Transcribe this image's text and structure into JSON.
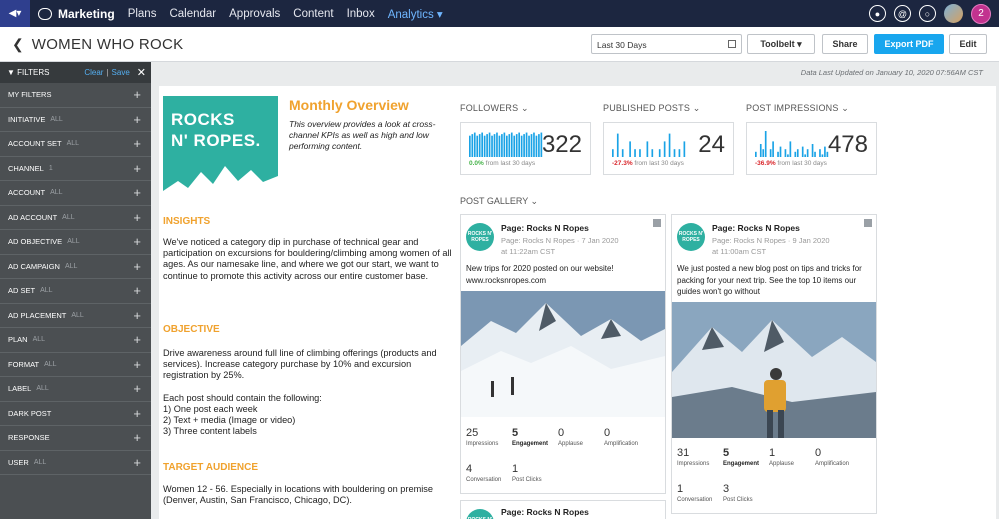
{
  "nav": {
    "brand": "Marketing",
    "links": [
      "Plans",
      "Calendar",
      "Approvals",
      "Content",
      "Inbox"
    ],
    "active": "Analytics",
    "notifications_count": "2"
  },
  "header": {
    "title": "WOMEN WHO ROCK",
    "date_range": "Last 30 Days",
    "toolbelt": "Toolbelt",
    "share": "Share",
    "export": "Export PDF",
    "edit": "Edit"
  },
  "sidebar": {
    "title": "FILTERS",
    "clear": "Clear",
    "save": "Save",
    "items": [
      {
        "label": "MY FILTERS",
        "value": ""
      },
      {
        "label": "INITIATIVE",
        "value": "ALL"
      },
      {
        "label": "ACCOUNT SET",
        "value": "ALL"
      },
      {
        "label": "CHANNEL",
        "value": "1"
      },
      {
        "label": "ACCOUNT",
        "value": "ALL"
      },
      {
        "label": "AD ACCOUNT",
        "value": "ALL"
      },
      {
        "label": "AD OBJECTIVE",
        "value": "ALL"
      },
      {
        "label": "AD CAMPAIGN",
        "value": "ALL"
      },
      {
        "label": "AD SET",
        "value": "ALL"
      },
      {
        "label": "AD PLACEMENT",
        "value": "ALL"
      },
      {
        "label": "PLAN",
        "value": "ALL"
      },
      {
        "label": "FORMAT",
        "value": "ALL"
      },
      {
        "label": "LABEL",
        "value": "ALL"
      },
      {
        "label": "DARK POST",
        "value": ""
      },
      {
        "label": "RESPONSE",
        "value": ""
      },
      {
        "label": "USER",
        "value": "ALL"
      }
    ]
  },
  "main": {
    "updated": "Data Last Updated on January 10, 2020 07:56AM CST",
    "logo_line1": "ROCKS",
    "logo_line2": "N' ROPES.",
    "overview_title": "Monthly Overview",
    "overview_desc": "This overview provides a look at cross-channel KPIs as well as high and low performing content.",
    "insights_h": "INSIGHTS",
    "insights_p": "We've noticed a category dip in purchase of technical gear and participation on excursions for bouldering/climbing among women of all ages.  As our namesake line, and where we got our start, we want to continue to promote this activity across our entire customer base.",
    "objective_h": "OBJECTIVE",
    "objective_p": "Drive awareness around full line of climbing offerings (products and services).  Increase category purchase by 10% and excursion registration by 25%.\n\nEach post should contain the following:\n1) One post each week\n2) Text + media (Image or video)\n3) Three content labels",
    "audience_h": "TARGET AUDIENCE",
    "audience_p": "Women 12 - 56.  Especially in locations with bouldering on premise (Denver, Austin, San Francisco, Chicago, DC)."
  },
  "kpis": [
    {
      "label": "FOLLOWERS",
      "value": "322",
      "delta": "0.0%",
      "delta_text": "from last 30 days",
      "color": "#1aa3e6"
    },
    {
      "label": "PUBLISHED POSTS",
      "value": "24",
      "delta": "-27.3%",
      "delta_text": "from last 30 days",
      "color": "#1aa3e6"
    },
    {
      "label": "POST IMPRESSIONS",
      "value": "478",
      "delta": "-36.9%",
      "delta_text": "from last 30 days",
      "color": "#1aa3e6"
    }
  ],
  "gallery": {
    "label": "POST GALLERY",
    "posts": [
      {
        "page": "Page: Rocks N Ropes",
        "meta1": "Page: Rocks N Ropes · 7 Jan 2020",
        "meta2": "at 11:22am CST",
        "text": "New trips for 2020 posted on our website!\nwww.rocksnropes.com",
        "stats": [
          {
            "n": "25",
            "t": "Impressions"
          },
          {
            "n": "5",
            "t": "Engagement"
          },
          {
            "n": "0",
            "t": "Applause"
          },
          {
            "n": "0",
            "t": "Amplification"
          },
          {
            "n": "4",
            "t": "Conversation"
          },
          {
            "n": "1",
            "t": "Post Clicks"
          }
        ]
      },
      {
        "page": "Page: Rocks N Ropes",
        "meta1": "Page: Rocks N Ropes · 9 Jan 2020",
        "meta2": "at 11:00am CST",
        "text": "We just posted a new blog post on tips and tricks for packing for your next trip. See the top 10 items our guides won't go without",
        "stats": [
          {
            "n": "31",
            "t": "Impressions"
          },
          {
            "n": "5",
            "t": "Engagement"
          },
          {
            "n": "1",
            "t": "Applause"
          },
          {
            "n": "0",
            "t": "Amplification"
          },
          {
            "n": "1",
            "t": "Conversation"
          },
          {
            "n": "3",
            "t": "Post Clicks"
          }
        ]
      },
      {
        "page": "Page: Rocks N Ropes"
      }
    ]
  },
  "avatar_text": "ROCKS N' ROPES"
}
